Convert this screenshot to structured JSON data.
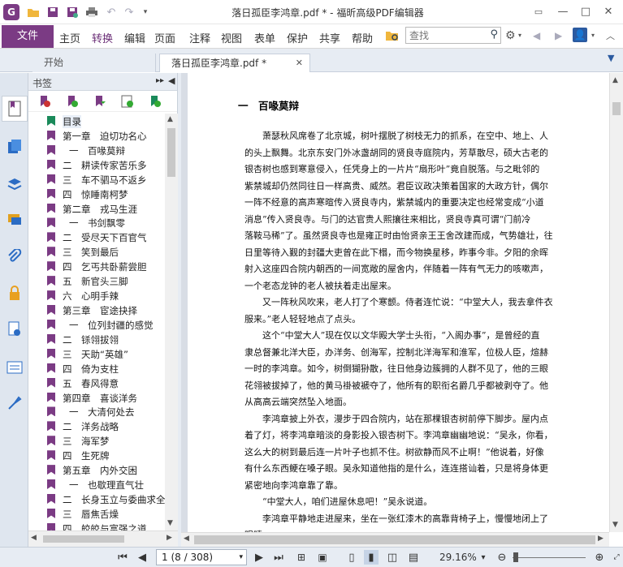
{
  "app": {
    "title": "落日孤臣李鸿章.pdf * - 福昕高级PDF编辑器"
  },
  "ribbon": {
    "file_label": "文件",
    "tabs": [
      "主页",
      "转换",
      "编辑",
      "页面",
      "注释",
      "视图",
      "表单",
      "保护",
      "共享",
      "帮助"
    ],
    "active_tab": "转换",
    "search_placeholder": "查找"
  },
  "doc_tabs": [
    {
      "label": "开始"
    },
    {
      "label": "落日孤臣李鸿章.pdf *"
    }
  ],
  "bookmarks": {
    "title": "书签",
    "items": [
      {
        "label": "目录",
        "level": 0,
        "color": "green"
      },
      {
        "label": "第一章　迫切功名心",
        "level": 0,
        "color": "purple"
      },
      {
        "label": "一　百喙莫辩",
        "level": 1,
        "color": "purple"
      },
      {
        "label": "二　耕读传家苦乐多",
        "level": 0,
        "color": "purple"
      },
      {
        "label": "三　车不驷马不返乡",
        "level": 0,
        "color": "purple"
      },
      {
        "label": "四　惊睡南柯梦",
        "level": 0,
        "color": "purple"
      },
      {
        "label": "第二章　戎马生涯",
        "level": 0,
        "color": "purple"
      },
      {
        "label": "一　书剑飘零",
        "level": 1,
        "color": "purple"
      },
      {
        "label": "二　受尽天下百官气",
        "level": 0,
        "color": "purple"
      },
      {
        "label": "三　笑到最后",
        "level": 0,
        "color": "purple"
      },
      {
        "label": "四　乞丐共卧薪尝胆",
        "level": 0,
        "color": "purple"
      },
      {
        "label": "五　新官头三脚",
        "level": 0,
        "color": "purple"
      },
      {
        "label": "六　心明手辣",
        "level": 0,
        "color": "purple"
      },
      {
        "label": "第三章　宦途抉择",
        "level": 0,
        "color": "purple"
      },
      {
        "label": "一　位列封疆的感觉",
        "level": 1,
        "color": "purple"
      },
      {
        "label": "二　铩翎拔翎",
        "level": 0,
        "color": "purple"
      },
      {
        "label": "三　天助“英雄”",
        "level": 0,
        "color": "purple"
      },
      {
        "label": "四　倚为支柱",
        "level": 0,
        "color": "purple"
      },
      {
        "label": "五　春风得意",
        "level": 0,
        "color": "purple"
      },
      {
        "label": "第四章　喜谈洋务",
        "level": 0,
        "color": "purple"
      },
      {
        "label": "一　大清何处去",
        "level": 1,
        "color": "purple"
      },
      {
        "label": "二　洋务战略",
        "level": 0,
        "color": "purple"
      },
      {
        "label": "三　海军梦",
        "level": 0,
        "color": "purple"
      },
      {
        "label": "四　生死牌",
        "level": 0,
        "color": "purple"
      },
      {
        "label": "第五章　内外交困",
        "level": 0,
        "color": "purple"
      },
      {
        "label": "一　也歇理直气壮",
        "level": 1,
        "color": "purple"
      },
      {
        "label": "二　长身玉立与委曲求全",
        "level": 0,
        "color": "purple"
      },
      {
        "label": "三　唇焦舌燥",
        "level": 0,
        "color": "purple"
      },
      {
        "label": "四　皎皎与富强之道",
        "level": 0,
        "color": "purple"
      }
    ]
  },
  "document": {
    "chapter_title": "一　百喙莫辩",
    "lines": [
      "　　萧瑟秋风席卷了北京城，树叶摆脱了树枝无力的抓系，在空中、地上、人",
      "的头上飘舞。北京东安门外冰盏胡同的贤良寺庭院内，芳草散尽，硕大古老的",
      "银杏树也感到寒意侵入，任凭身上的一片片“扇形叶”竟自脱落。与之毗邻的",
      "紫禁城却仍然同往日一样高贵、威然。君臣议政决策着国家的大政方针，偶尔",
      "一阵不经意的高声寒暄传入贤良寺内，紫禁城内的重要决定也经常变成“小道",
      "消息”传入贤良寺。与门的达官贵人熙攘往来相比，贤良寺真可谓“门前冷",
      "落鞍马稀”了。虽然贤良寺也是雍正时由怡贤亲王王舍改建而成，气势雄壮，往",
      "日里等待入觐的封疆大吏曾在此下榻，而今物换星移，昨事今非。夕阳的余晖",
      "射入这座四合院内朝西的一间宽敞的屋舍内，伴随着一阵有气无力的咳嗽声，",
      "一个老态龙钟的老人被扶着走出屋来。",
      "　　又一阵秋风吹来，老人打了个寒颤。侍者连忙说：“中堂大人，我去拿件衣",
      "服来。”老人轻轻地点了点头。",
      "　　这个“中堂大人”现在仅以文华殿大学士头衔，“入阁办事”，是曾经的直",
      "隶总督兼北洋大臣，办洋务、创海军，控制北洋海军和淮军，位极人臣，煊赫",
      "一时的李鸿章。如今，树倒猢狲散，往日他身边簇拥的人群不见了，他的三眼",
      "花翎被拔掉了，他的黄马褂被褫夺了，他所有的职衔名爵几乎都被剥夺了。他",
      "从高高云端突然坠入地面。",
      "　　李鸿章披上外衣，漫步于四合院内，站在那棵银杏树前停下脚步。屋内点",
      "着了灯，将李鸿章暗淡的身影投入银杏树下。李鸿章幽幽地说：“吴永，你看，",
      "这么大的树到最后连一片叶子也抓不住。树欲静而风不止啊！”他说着，好像",
      "有什么东西鲠在嗓子眼。吴永知道他指的是什么，连连搭讪着，只是将身体更",
      "紧密地向李鸿章靠了靠。",
      "　　“中堂大人，咱们进屋休息吧！”吴永说道。",
      "　　李鸿章平静地走进屋来，坐在一张红漆木的高靠背椅子上，慢慢地闭上了",
      "眼睛。"
    ]
  },
  "status": {
    "page_display": "1 (8 / 308)",
    "zoom": "29.16%"
  }
}
